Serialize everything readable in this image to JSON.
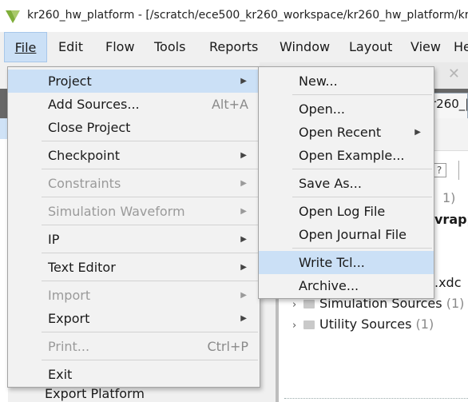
{
  "title_bar": {
    "text": "kr260_hw_platform - [/scratch/ece500_kr260_workspace/kr260_hw_platform/kr260_h",
    "logo_icon": "vivado-logo-icon"
  },
  "menubar": [
    {
      "id": "file",
      "label": "File",
      "active": true
    },
    {
      "id": "edit",
      "label": "Edit"
    },
    {
      "id": "flow",
      "label": "Flow"
    },
    {
      "id": "tools",
      "label": "Tools"
    },
    {
      "id": "reports",
      "label": "Reports"
    },
    {
      "id": "window",
      "label": "Window"
    },
    {
      "id": "layout",
      "label": "Layout"
    },
    {
      "id": "view",
      "label": "View"
    },
    {
      "id": "help",
      "label": "He"
    }
  ],
  "file_menu": [
    {
      "label": "Project",
      "submenu": true,
      "highlight": true
    },
    {
      "label": "Add Sources...",
      "shortcut": "Alt+A"
    },
    {
      "label": "Close Project"
    },
    {
      "label": "Checkpoint",
      "submenu": true
    },
    {
      "label": "Constraints",
      "submenu": true,
      "disabled": true
    },
    {
      "label": "Simulation Waveform",
      "submenu": true,
      "disabled": true
    },
    {
      "label": "IP",
      "submenu": true
    },
    {
      "label": "Text Editor",
      "submenu": true
    },
    {
      "label": "Import",
      "submenu": true,
      "disabled": true
    },
    {
      "label": "Export",
      "submenu": true
    },
    {
      "label": "Print...",
      "shortcut": "Ctrl+P",
      "disabled": true
    },
    {
      "label": "Exit"
    }
  ],
  "project_menu": [
    {
      "label": "New..."
    },
    {
      "label": "Open..."
    },
    {
      "label": "Open Recent",
      "submenu": true
    },
    {
      "label": "Open Example..."
    },
    {
      "label": "Save As..."
    },
    {
      "label": "Open Log File"
    },
    {
      "label": "Open Journal File"
    },
    {
      "label": "Write Tcl...",
      "highlight": true
    },
    {
      "label": "Archive..."
    }
  ],
  "background": {
    "tab_fragment": "r260_|",
    "count_fragment": "1)",
    "wrapper_fragment": "vrapp",
    "xdc_fragment": ".xdc",
    "tree": [
      {
        "label": "Simulation Sources",
        "count": "(1)"
      },
      {
        "label": "Utility Sources",
        "count": "(1)"
      }
    ],
    "bottom_item": "Export Platform",
    "help_button": "?"
  },
  "colors": {
    "highlight": "#cbe0f6",
    "menu_bg": "#f2f2f2",
    "dark_bar": "#676767"
  }
}
